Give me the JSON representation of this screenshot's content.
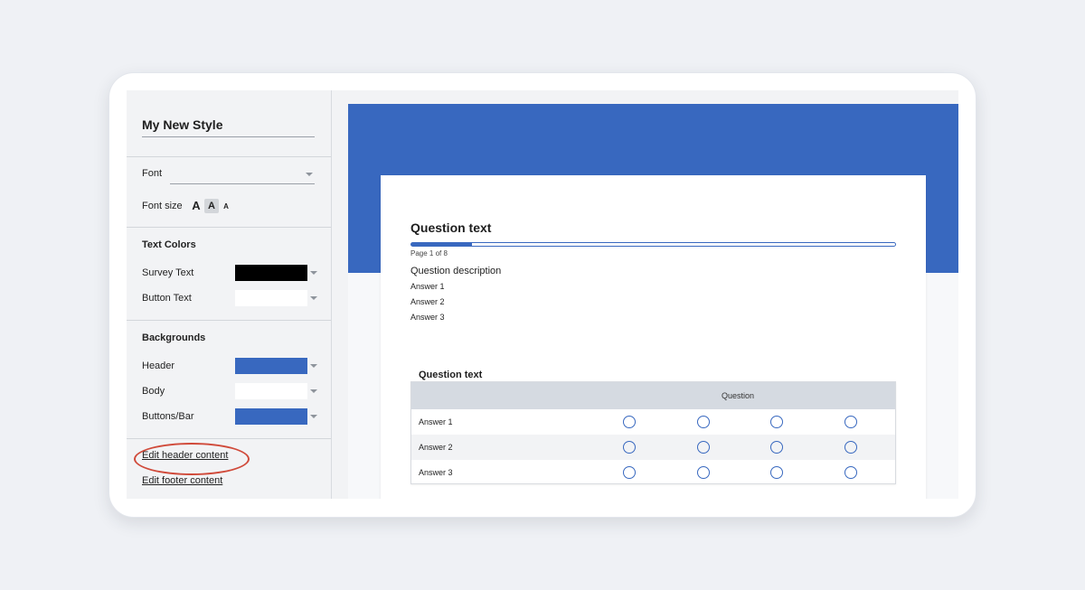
{
  "style_panel": {
    "style_name": "My New Style",
    "font_label": "Font",
    "font_value": "",
    "font_size_label": "Font size",
    "font_sizes": [
      {
        "label": "A",
        "active": false
      },
      {
        "label": "A",
        "active": true
      },
      {
        "label": "A",
        "active": false
      }
    ],
    "text_colors": {
      "heading": "Text Colors",
      "survey_text": {
        "label": "Survey Text",
        "color": "#000000"
      },
      "button_text": {
        "label": "Button Text",
        "color": "#ffffff"
      }
    },
    "backgrounds": {
      "heading": "Backgrounds",
      "header": {
        "label": "Header",
        "color": "#3868bf"
      },
      "body": {
        "label": "Body",
        "color": "#ffffff"
      },
      "buttons_bar": {
        "label": "Buttons/Bar",
        "color": "#3868bf"
      }
    },
    "links": {
      "edit_header": "Edit header content",
      "edit_footer": "Edit footer content"
    }
  },
  "preview": {
    "header_color": "#3868bf",
    "question_title": "Question text",
    "progress_fraction": 0.125,
    "page_indicator": "Page 1 of 8",
    "question_description": "Question description",
    "answers": [
      "Answer 1",
      "Answer 2",
      "Answer 3"
    ],
    "matrix": {
      "title": "Question text",
      "column_header": "Question",
      "rows": [
        "Answer 1",
        "Answer 2",
        "Answer 3"
      ],
      "options_per_row": 4
    }
  }
}
